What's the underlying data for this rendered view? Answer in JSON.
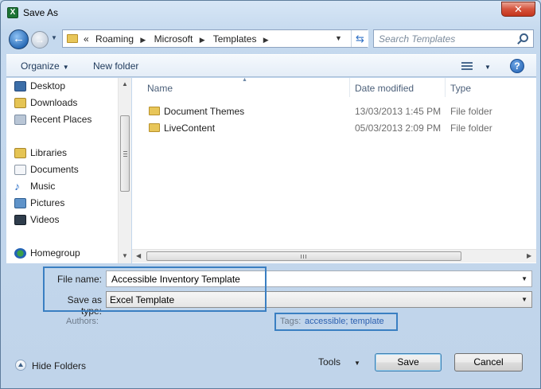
{
  "window": {
    "title": "Save As",
    "app_icon_letter": "X"
  },
  "address": {
    "crumbs": [
      "Roaming",
      "Microsoft",
      "Templates"
    ],
    "overflow": "«",
    "search_placeholder": "Search Templates"
  },
  "toolbar": {
    "organize_label": "Organize",
    "new_folder_label": "New folder",
    "help_glyph": "?"
  },
  "nav": {
    "items": [
      {
        "label": "Desktop",
        "icon": "desktop-icon"
      },
      {
        "label": "Downloads",
        "icon": "downloads-icon"
      },
      {
        "label": "Recent Places",
        "icon": "recent-places-icon"
      },
      {
        "label": "Libraries",
        "icon": "libraries-icon"
      },
      {
        "label": "Documents",
        "icon": "documents-icon"
      },
      {
        "label": "Music",
        "icon": "music-icon"
      },
      {
        "label": "Pictures",
        "icon": "pictures-icon"
      },
      {
        "label": "Videos",
        "icon": "videos-icon"
      },
      {
        "label": "Homegroup",
        "icon": "homegroup-icon"
      }
    ]
  },
  "files": {
    "columns": {
      "name": "Name",
      "date": "Date modified",
      "type": "Type"
    },
    "rows": [
      {
        "name": "Document Themes",
        "date": "13/03/2013 1:45 PM",
        "type": "File folder"
      },
      {
        "name": "LiveContent",
        "date": "05/03/2013 2:09 PM",
        "type": "File folder"
      }
    ]
  },
  "form": {
    "file_name_label": "File name:",
    "file_name_value": "Accessible Inventory Template",
    "save_type_label": "Save as type:",
    "save_type_value": "Excel Template",
    "authors_label": "Authors:",
    "tags_label": "Tags:",
    "tags_value": "accessible; template"
  },
  "footer": {
    "hide_folders_label": "Hide Folders",
    "tools_label": "Tools",
    "save_label": "Save",
    "cancel_label": "Cancel"
  },
  "colors": {
    "accent": "#3a7fc2",
    "close_button": "#c4351d",
    "folder": "#e8c659"
  }
}
